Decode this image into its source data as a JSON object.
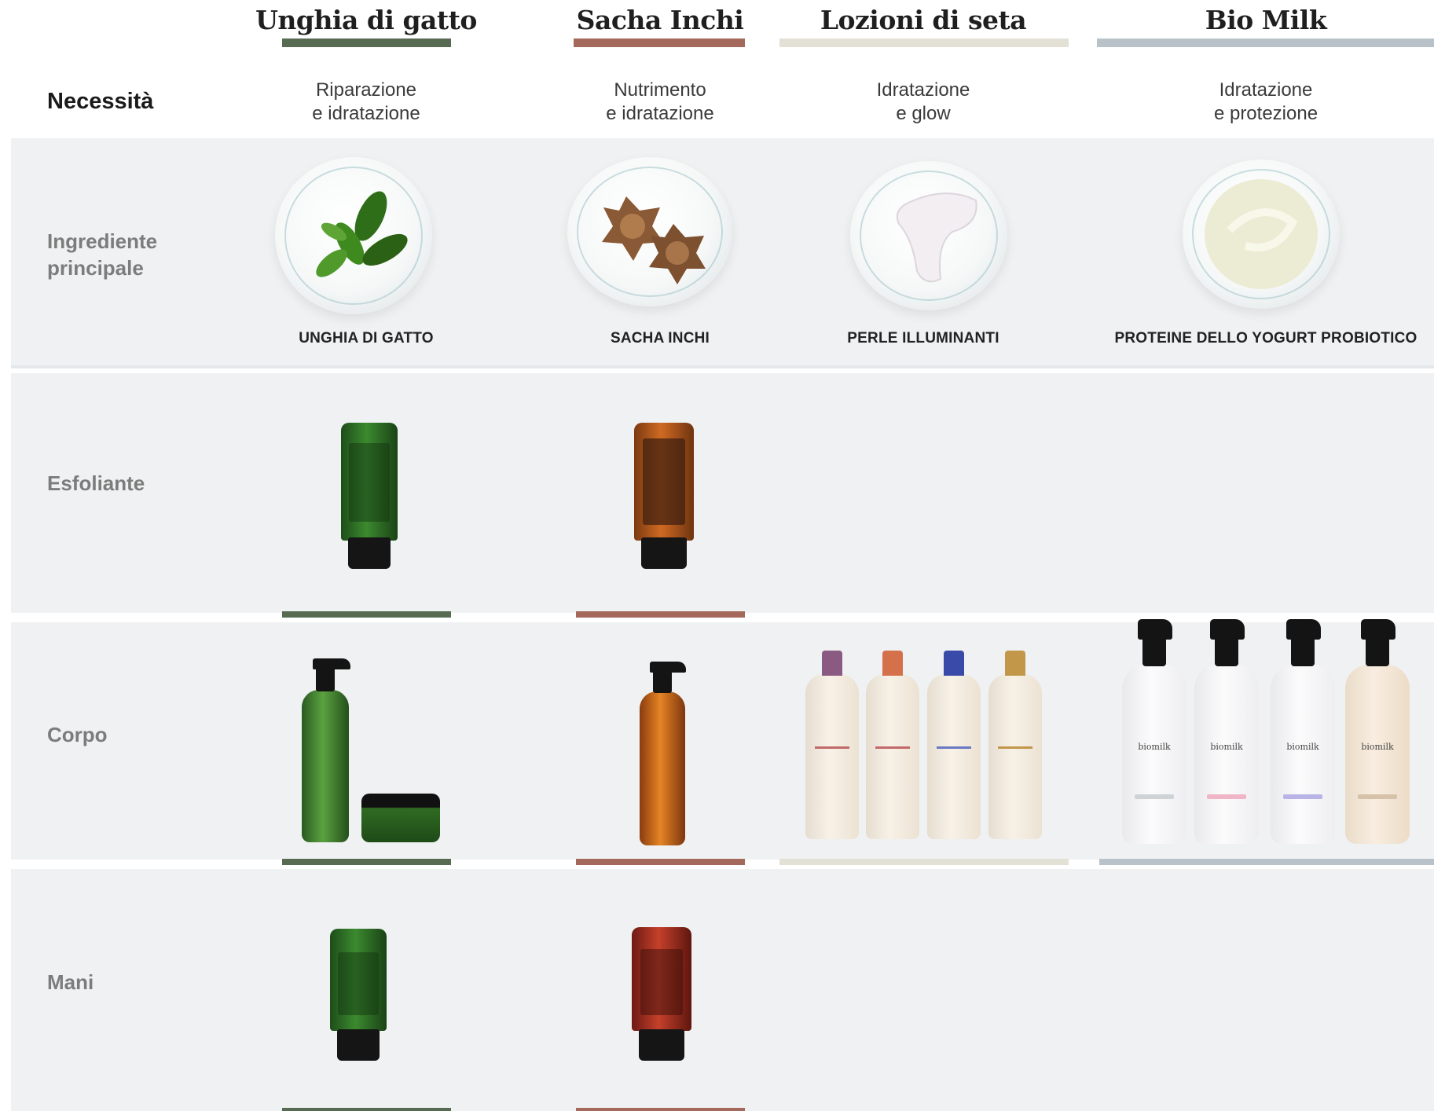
{
  "columns": [
    {
      "title": "Unghia di gatto",
      "need_line1": "Riparazione",
      "need_line2": "e idratazione",
      "ingredient": "UNGHIA DI GATTO",
      "color": "#566b52"
    },
    {
      "title": "Sacha Inchi",
      "need_line1": "Nutrimento",
      "need_line2": "e idratazione",
      "ingredient": "SACHA INCHI",
      "color": "#a4695a"
    },
    {
      "title": "Lozioni di seta",
      "need_line1": "Idratazione",
      "need_line2": "e glow",
      "ingredient": "PERLE ILLUMINANTI",
      "color": "#e3e1d6"
    },
    {
      "title": "Bio Milk",
      "need_line1": "Idratazione",
      "need_line2": "e protezione",
      "ingredient": "PROTEINE DELLO YOGURT PROBIOTICO",
      "color": "#b9c2c8"
    }
  ],
  "rows": {
    "need": "Necessità",
    "ingredient_line1": "Ingrediente",
    "ingredient_line2": "principale",
    "exfoliant": "Esfoliante",
    "body": "Corpo",
    "hands": "Mani"
  },
  "product_text": {
    "brand_biomilk": "biomilk"
  }
}
